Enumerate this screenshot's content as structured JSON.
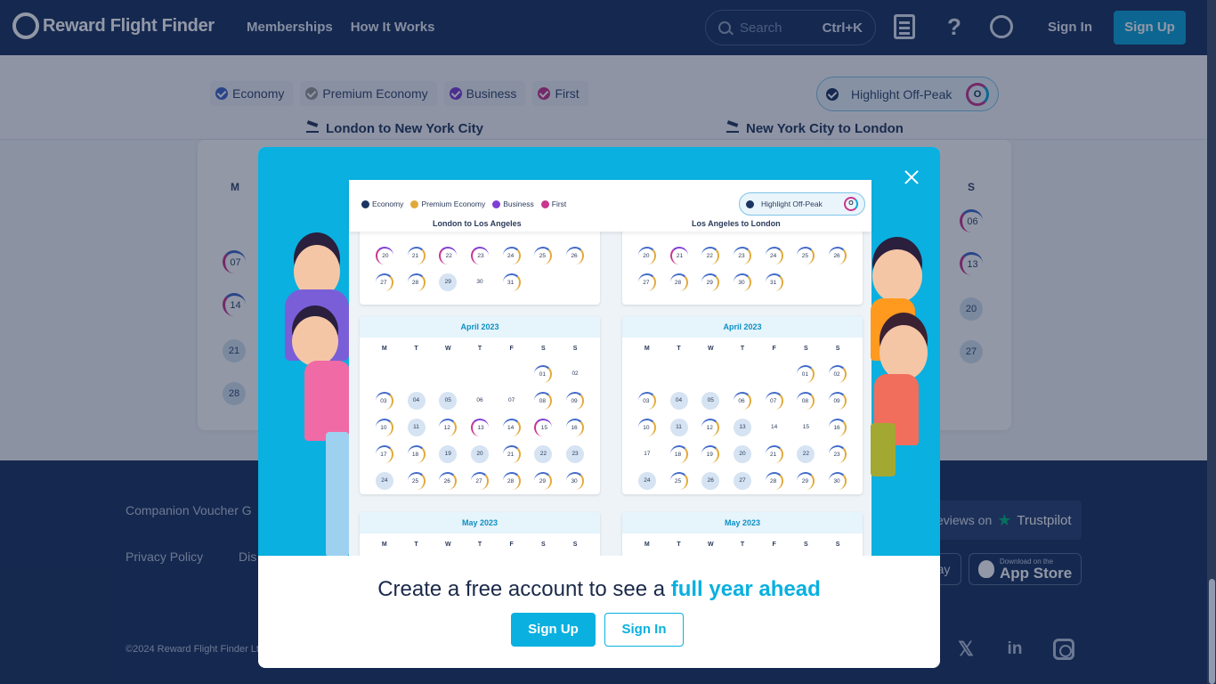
{
  "header": {
    "brand": "Reward Flight Finder",
    "nav": [
      "Memberships",
      "How It Works"
    ],
    "search_placeholder": "Search",
    "search_shortcut": "Ctrl+K",
    "help_glyph": "?",
    "sign_in": "Sign In",
    "sign_up": "Sign Up"
  },
  "filters": {
    "cabins": [
      {
        "label": "Economy",
        "color": "#4169c9"
      },
      {
        "label": "Premium Economy",
        "color": "#9a9a9a"
      },
      {
        "label": "Business",
        "color": "#7e3fd6"
      },
      {
        "label": "First",
        "color": "#c9358f"
      }
    ],
    "off_peak_label": "Highlight Off-Peak",
    "off_peak_badge": "O",
    "route_out": "London to New York City",
    "route_back": "New York City to London"
  },
  "background_calendar": {
    "weekday_left": "M",
    "weekday_right": "S",
    "left_days": [
      "07",
      "14",
      "21",
      "28"
    ],
    "right_days": [
      "06",
      "13",
      "20",
      "27"
    ]
  },
  "footer": {
    "companion": "Companion Voucher G",
    "privacy": "Privacy Policy",
    "dis": "Dis",
    "copyright": "©2024 Reward Flight Finder Lt",
    "trustpilot_text": "eviews on",
    "trustpilot_star": "★",
    "trustpilot_brand": "Trustpilot",
    "google_play_fragment": "ay",
    "appstore_small": "Download on the",
    "appstore_big": "App Store",
    "social_x": "𝕏",
    "social_linkedin": "in"
  },
  "modal": {
    "close_label": "close",
    "mock": {
      "cabins": [
        {
          "label": "Economy",
          "color": "#1c3461"
        },
        {
          "label": "Premium Economy",
          "color": "#e1a93a"
        },
        {
          "label": "Business",
          "color": "#7e3fd6"
        },
        {
          "label": "First",
          "color": "#c9358f"
        }
      ],
      "off_peak": "Highlight Off-Peak",
      "off_peak_badge": "O",
      "route_out": "London to Los Angeles",
      "route_back": "Los Angeles to London",
      "weekdays": [
        "M",
        "T",
        "W",
        "T",
        "F",
        "S",
        "S"
      ],
      "march_rows_left": [
        [
          "20",
          "21",
          "22",
          "23",
          "24",
          "25",
          "26"
        ],
        [
          "27",
          "28",
          "29",
          "30",
          "31",
          "",
          ""
        ]
      ],
      "march_rows_right": [
        [
          "20",
          "21",
          "22",
          "23",
          "24",
          "25",
          "26"
        ],
        [
          "27",
          "28",
          "29",
          "30",
          "31",
          "",
          ""
        ]
      ],
      "april_title": "April 2023",
      "april_rows": [
        [
          "",
          "",
          "",
          "",
          "",
          "01",
          "02"
        ],
        [
          "03",
          "04",
          "05",
          "06",
          "07",
          "08",
          "09"
        ],
        [
          "10",
          "11",
          "12",
          "13",
          "14",
          "15",
          "16"
        ],
        [
          "17",
          "18",
          "19",
          "20",
          "21",
          "22",
          "23"
        ],
        [
          "24",
          "25",
          "26",
          "27",
          "28",
          "29",
          "30"
        ]
      ],
      "may_title": "May 2023"
    },
    "headline_prefix": "Create a free account to see a ",
    "headline_highlight": "full year ahead",
    "sign_up": "Sign Up",
    "sign_in": "Sign In"
  }
}
